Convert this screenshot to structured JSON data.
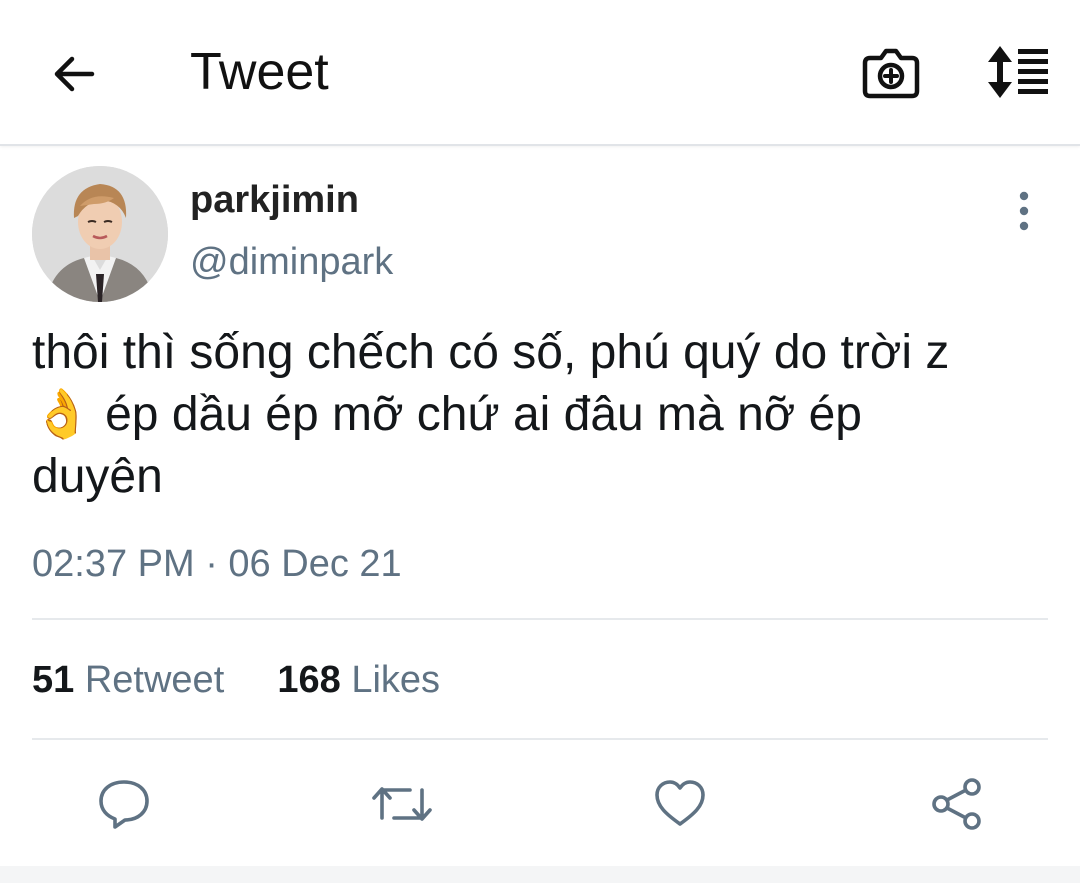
{
  "header": {
    "title": "Tweet",
    "back_icon": "arrow-left-icon",
    "camera_icon": "camera-plus-icon",
    "sort_icon": "sort-list-icon"
  },
  "tweet": {
    "display_name": "parkjimin",
    "handle": "@diminpark",
    "text": "thôi thì sống chếch có số, phú quý do trời z\n👌 ép dầu ép mỡ chứ ai đâu mà nỡ ép\nduyên",
    "timestamp": "02:37 PM · 06 Dec 21",
    "retweet_count": "51",
    "retweet_label": "Retweet",
    "likes_count": "168",
    "likes_label": "Likes"
  },
  "actions": {
    "reply_icon": "reply-icon",
    "retweet_icon": "retweet-icon",
    "like_icon": "heart-icon",
    "share_icon": "share-icon"
  },
  "colors": {
    "text": "#14171a",
    "muted": "#5f7283",
    "divider": "#e6e9ec",
    "icon": "#5f7283"
  }
}
